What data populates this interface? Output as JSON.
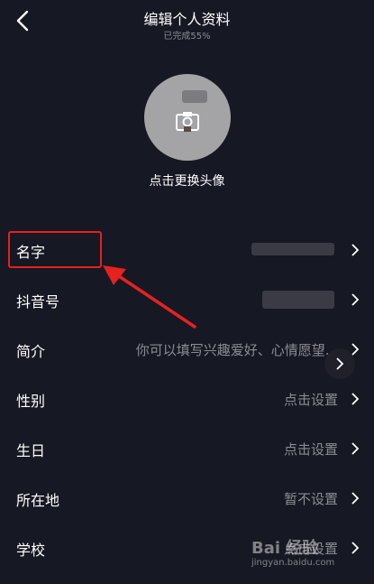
{
  "header": {
    "title": "编辑个人资料",
    "subtitle": "已完成55%"
  },
  "avatar": {
    "label": "点击更换头像"
  },
  "rows": [
    {
      "label": "名字",
      "value": ""
    },
    {
      "label": "抖音号",
      "value": ""
    },
    {
      "label": "简介",
      "value": "你可以填写兴趣爱好、心情愿望..."
    },
    {
      "label": "性别",
      "value": "点击设置"
    },
    {
      "label": "生日",
      "value": "点击设置"
    },
    {
      "label": "所在地",
      "value": "暂不设置"
    },
    {
      "label": "学校",
      "value": "点击设置"
    }
  ],
  "watermark": {
    "logo": "Bai 经验",
    "url": "jingyan.baidu.com"
  },
  "colors": {
    "background": "#161823",
    "annotation": "#e6211f",
    "muted_text": "#8b8c93"
  }
}
